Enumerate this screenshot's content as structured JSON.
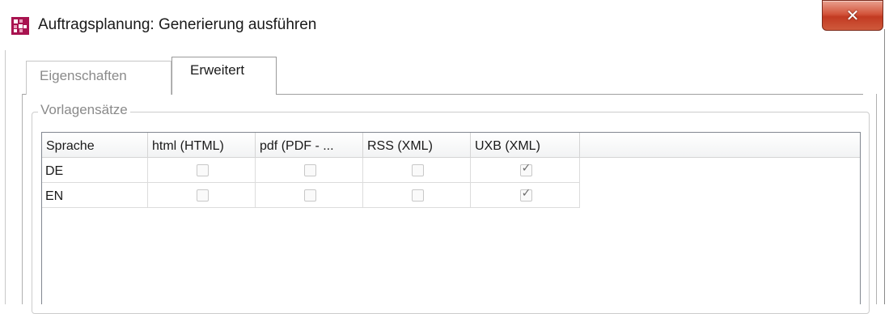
{
  "window": {
    "title": "Auftragsplanung: Generierung ausführen",
    "close_glyph": "✕",
    "close_icon": "close-icon",
    "app_icon": "app-logo-icon",
    "accent": "#a8134f"
  },
  "tabs": [
    {
      "label": "Eigenschaften",
      "active": false
    },
    {
      "label": "Erweitert",
      "active": true
    }
  ],
  "group": {
    "label": "Vorlagensätze"
  },
  "table": {
    "columns": [
      "Sprache",
      "html (HTML)",
      "pdf (PDF - ...",
      "RSS (XML)",
      "UXB (XML)"
    ],
    "rows": [
      {
        "language": "DE",
        "checks": [
          false,
          false,
          false,
          true
        ]
      },
      {
        "language": "EN",
        "checks": [
          false,
          false,
          false,
          true
        ]
      }
    ],
    "check_glyph": "✓"
  }
}
